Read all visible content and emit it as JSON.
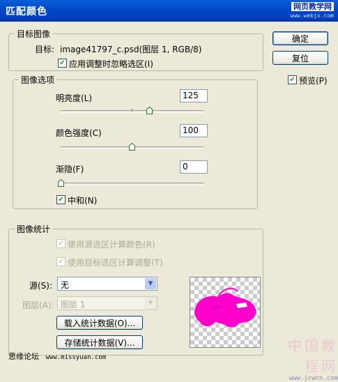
{
  "window": {
    "title": "匹配颜色",
    "watermark_top": "网页教学网",
    "watermark_url": "www.webjx.com"
  },
  "buttons": {
    "ok": "确定",
    "reset": "复位",
    "load_stats": "载入统计数据(O)...",
    "save_stats": "存储统计数据(V)..."
  },
  "preview": {
    "label": "预览(P)",
    "checked": true
  },
  "target_image": {
    "legend": "目标图像",
    "target_label": "目标:",
    "target_value": "image41797_c.psd(图层 1, RGB/8)",
    "ignore_selection_label": "应用调整时忽略选区(I)",
    "ignore_selection_checked": true
  },
  "image_options": {
    "legend": "图像选项",
    "luminance": {
      "label": "明亮度(L)",
      "value": "125",
      "level": 0.625
    },
    "color_intensity": {
      "label": "颜色强度(C)",
      "value": "100",
      "level": 0.5
    },
    "fade": {
      "label": "渐隐(F)",
      "value": "0",
      "level": 0.0
    },
    "neutralize": {
      "label": "中和(N)",
      "checked": true
    }
  },
  "image_statistics": {
    "legend": "图像统计",
    "use_source_selection": "使用源选区计算颜色(R)",
    "use_target_selection": "使用目标选区计算调整(T)",
    "source_label": "源(S):",
    "source_value": "无",
    "layer_label": "图层(A):",
    "layer_value": "图层 1"
  },
  "footer": {
    "left_text": "思缘论坛",
    "left_url": "www.missyuan.com",
    "right_art": "中国教程网",
    "right_url": "www.jcwcn.com"
  },
  "colors": {
    "titlebar": "#0A5FD8",
    "dialog_bg": "#ECE9D8",
    "preview_shape": "#FF00CC"
  }
}
